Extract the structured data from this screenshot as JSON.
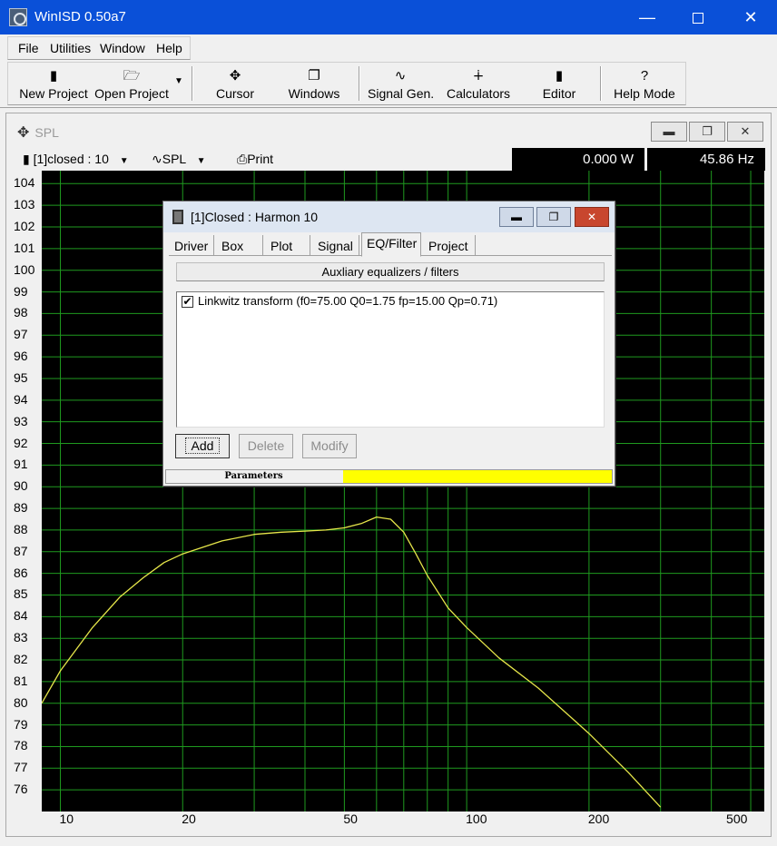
{
  "app": {
    "title": "WinISD 0.50a7",
    "min": "—",
    "close": "✕"
  },
  "menu": [
    "File",
    "Utilities",
    "Window",
    "Help"
  ],
  "toolbar": {
    "new_project": "New Project",
    "open_project": "Open Project",
    "cursor": "Cursor",
    "windows": "Windows",
    "signal_gen": "Signal Gen.",
    "calculators": "Calculators",
    "editor": "Editor",
    "help_mode": "Help Mode",
    "help_icon": "?"
  },
  "spl_window": {
    "title": "SPL",
    "project_select": "[1]closed : 10",
    "plot_select": "SPL",
    "print": "Print",
    "power_readout": "0.000 W",
    "freq_readout": "45.86 Hz"
  },
  "dialog": {
    "title": "[1]Closed : Harmon 10",
    "tabs": [
      "Driver",
      "Box",
      "Plot",
      "Signal",
      "EQ/Filter",
      "Project"
    ],
    "active_tab": "EQ/Filter",
    "aux_header": "Auxliary equalizers / filters",
    "items": [
      {
        "checked": true,
        "check_glyph": "✔",
        "label": "Linkwitz transform (f0=75.00 Q0=1.75 fp=15.00 Qp=0.71)"
      }
    ],
    "buttons": {
      "add": "Add",
      "delete": "Delete",
      "modify": "Modify"
    },
    "status_label": "Parameters",
    "status_color": "#ffff00"
  },
  "chart_data": {
    "type": "line",
    "x_scale": "log",
    "xlim": [
      9,
      540
    ],
    "ylim": [
      75,
      104.6
    ],
    "y_ticks": [
      104,
      103,
      102,
      101,
      100,
      99,
      98,
      97,
      96,
      95,
      94,
      93,
      92,
      91,
      90,
      89,
      88,
      87,
      86,
      85,
      84,
      83,
      82,
      81,
      80,
      79,
      78,
      77,
      76
    ],
    "x_ticks": [
      {
        "value": 10,
        "label": "10"
      },
      {
        "value": 20,
        "label": "20"
      },
      {
        "value": 50,
        "label": "50"
      },
      {
        "value": 100,
        "label": "100"
      },
      {
        "value": 200,
        "label": "200"
      },
      {
        "value": 500,
        "label": "500"
      }
    ],
    "x_grid": [
      10,
      20,
      30,
      40,
      50,
      60,
      70,
      80,
      90,
      100,
      200,
      300,
      400,
      500
    ],
    "grid": true,
    "colors": {
      "background": "#000000",
      "grid": "#1f9a1f",
      "line": "#e6e64a"
    },
    "series": [
      {
        "x": [
          9,
          10,
          12,
          14,
          16,
          18,
          20,
          25,
          30,
          35,
          40,
          45,
          50,
          55,
          60,
          65,
          70,
          75,
          80,
          90,
          100,
          120,
          150,
          200,
          250,
          300
        ],
        "y": [
          80.0,
          81.5,
          83.5,
          84.9,
          85.8,
          86.5,
          86.9,
          87.5,
          87.8,
          87.9,
          87.95,
          88.0,
          88.1,
          88.3,
          88.6,
          88.5,
          87.9,
          86.9,
          85.9,
          84.4,
          83.5,
          82.1,
          80.7,
          78.6,
          76.8,
          75.2
        ]
      }
    ]
  }
}
